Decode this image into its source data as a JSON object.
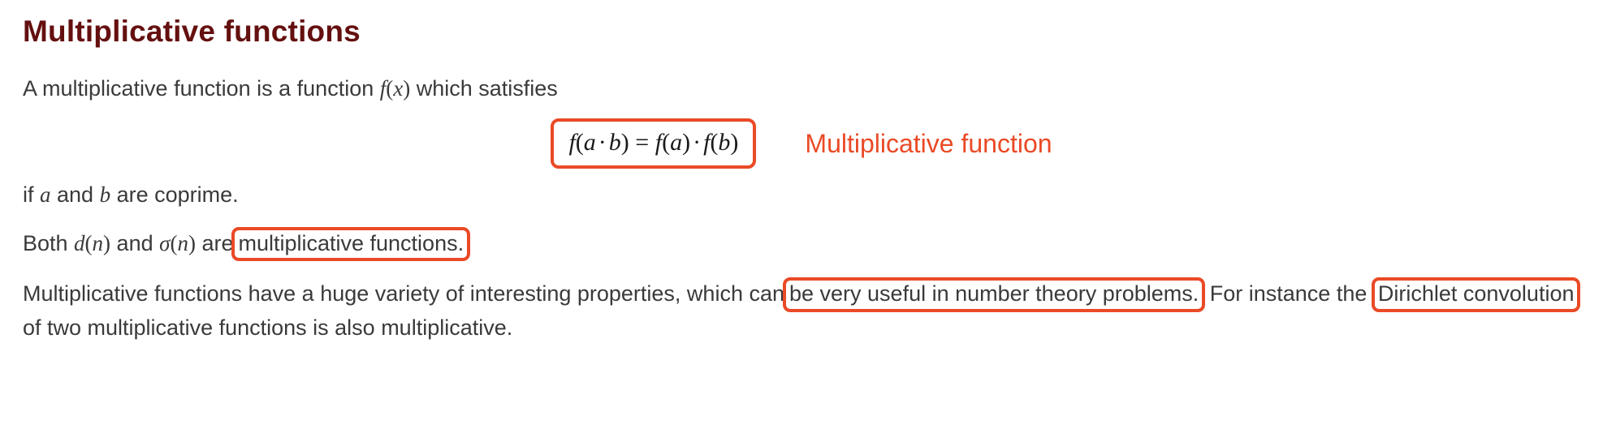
{
  "heading": "Multiplicative functions",
  "p1": {
    "pre": "A multiplicative function is a function ",
    "fx_f": "f",
    "fx_open": "(",
    "fx_x": "x",
    "fx_close": ")",
    "post": " which satisfies"
  },
  "equation": {
    "f1": "f",
    "open1": "(",
    "a1": "a",
    "cdot1": "·",
    "b1": "b",
    "close1": ")",
    "eq": " = ",
    "f2": "f",
    "open2": "(",
    "a2": "a",
    "close2": ")",
    "cdot2": "·",
    "f3": "f",
    "open3": "(",
    "b3": "b",
    "close3": ")",
    "label": "Multiplicative function"
  },
  "p2": {
    "pre": "if ",
    "a": "a",
    "mid": " and ",
    "b": "b",
    "post": " are coprime."
  },
  "p3": {
    "pre": "Both ",
    "d": "d",
    "dopen": "(",
    "dn": "n",
    "dclose": ")",
    "mid": " and ",
    "sigma": "σ",
    "sopen": "(",
    "sn": "n",
    "sclose": ")",
    "are": " are",
    "hl": " multiplicative functions."
  },
  "p4": {
    "t1": "Multiplicative functions have a huge variety of interesting properties, which can",
    "hl1": " be very useful in number theory problems.",
    "t2": " For instance the ",
    "hl2": "Dirichlet convolution",
    "t3": " of two multiplicative functions is also multiplicative."
  }
}
